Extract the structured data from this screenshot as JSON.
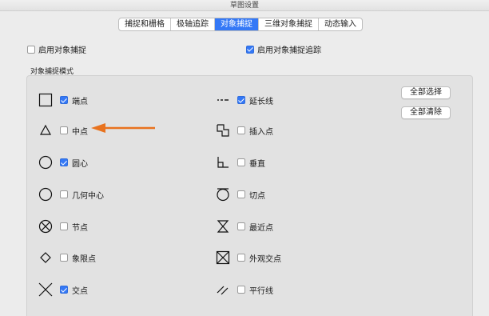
{
  "window": {
    "title": "草图设置"
  },
  "tabs": [
    {
      "label": "捕捉和栅格",
      "active": false
    },
    {
      "label": "极轴追踪",
      "active": false
    },
    {
      "label": "对象捕捉",
      "active": true
    },
    {
      "label": "三维对象捕捉",
      "active": false
    },
    {
      "label": "动态输入",
      "active": false
    }
  ],
  "options": {
    "enable_snap": {
      "label": "启用对象捕捉",
      "checked": false
    },
    "enable_tracking": {
      "label": "启用对象捕捉追踪",
      "checked": true
    }
  },
  "modes_section": {
    "label": "对象捕捉模式"
  },
  "modes_left": [
    {
      "label": "端点",
      "checked": true,
      "icon": "endpoint-square-icon"
    },
    {
      "label": "中点",
      "checked": false,
      "icon": "midpoint-triangle-icon"
    },
    {
      "label": "圆心",
      "checked": true,
      "icon": "center-circle-icon"
    },
    {
      "label": "几何中心",
      "checked": false,
      "icon": "geometric-center-circle-icon"
    },
    {
      "label": "节点",
      "checked": false,
      "icon": "node-circle-x-icon"
    },
    {
      "label": "象限点",
      "checked": false,
      "icon": "quadrant-diamond-icon"
    },
    {
      "label": "交点",
      "checked": true,
      "icon": "intersection-x-icon"
    }
  ],
  "modes_right": [
    {
      "label": "延长线",
      "checked": true,
      "icon": "extension-dashes-icon"
    },
    {
      "label": "插入点",
      "checked": false,
      "icon": "insertion-squares-icon"
    },
    {
      "label": "垂直",
      "checked": false,
      "icon": "perpendicular-icon"
    },
    {
      "label": "切点",
      "checked": false,
      "icon": "tangent-circle-icon"
    },
    {
      "label": "最近点",
      "checked": false,
      "icon": "nearest-hourglass-icon"
    },
    {
      "label": "外观交点",
      "checked": false,
      "icon": "apparent-intersection-box-x-icon"
    },
    {
      "label": "平行线",
      "checked": false,
      "icon": "parallel-lines-icon"
    }
  ],
  "buttons": {
    "select_all": "全部选择",
    "clear_all": "全部清除"
  },
  "colors": {
    "accent": "#3478f6",
    "callout_arrow": "#e8731f"
  }
}
